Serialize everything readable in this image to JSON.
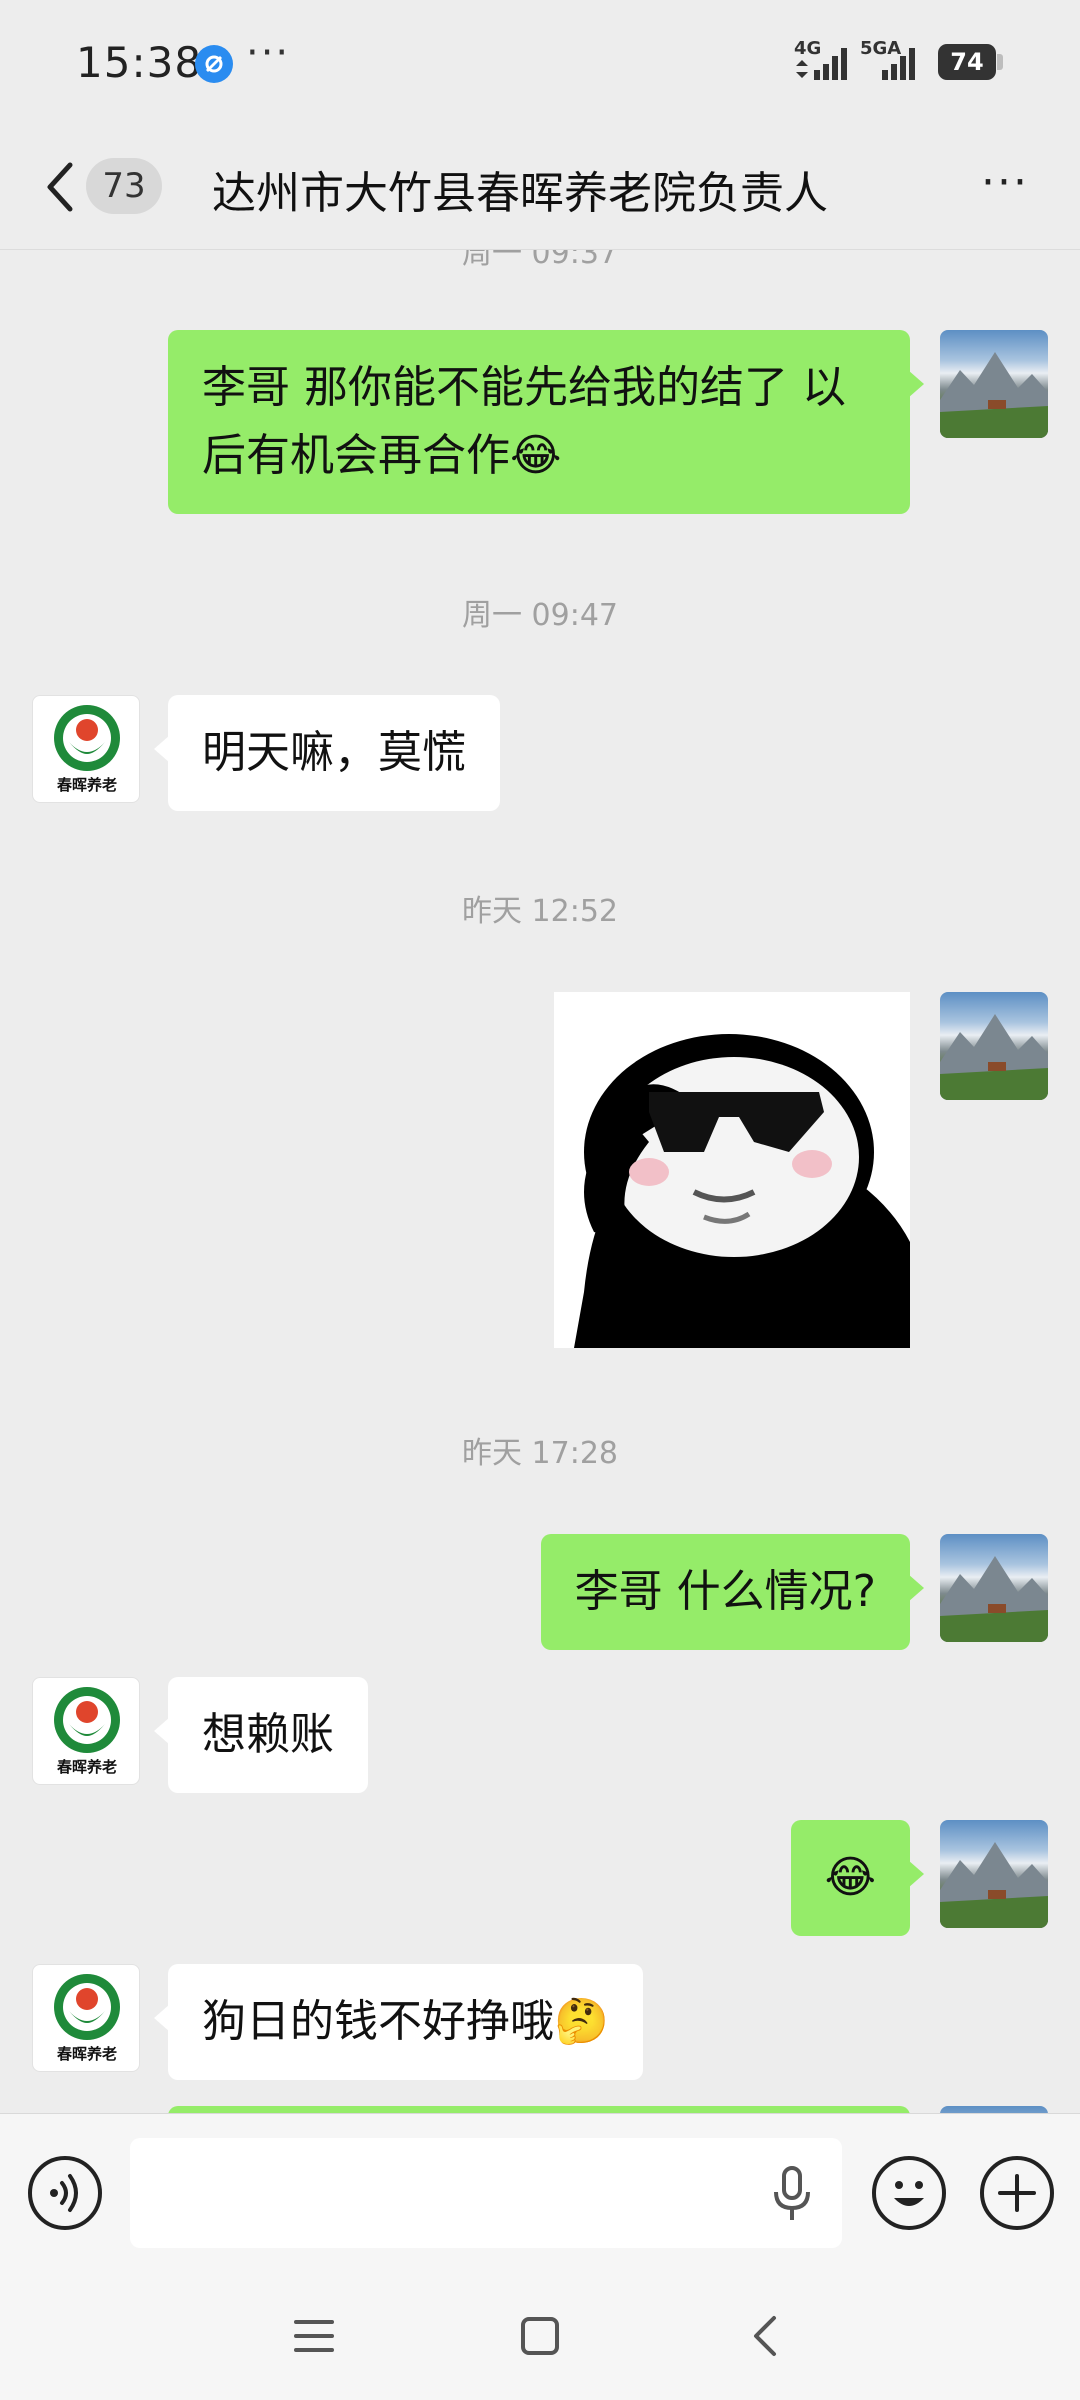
{
  "status_bar": {
    "time": "15:38",
    "more": "···",
    "network_1": "4G",
    "network_2": "5GA",
    "battery": "74"
  },
  "header": {
    "unread_count": "73",
    "title": "达州市大竹县春晖养老院负责人",
    "more": "···"
  },
  "messages": [
    {
      "type": "time",
      "text": "周一 09:37"
    },
    {
      "type": "text",
      "side": "self",
      "text": "李哥 那你能不能先给我的结了  以后有机会再合作😂"
    },
    {
      "type": "time",
      "text": "周一 09:47"
    },
    {
      "type": "text",
      "side": "other",
      "text": "明天嘛，莫慌"
    },
    {
      "type": "time",
      "text": "昨天 12:52"
    },
    {
      "type": "sticker",
      "side": "self",
      "sticker": "panda-sunglasses"
    },
    {
      "type": "time",
      "text": "昨天 17:28"
    },
    {
      "type": "text",
      "side": "self",
      "text": "李哥 什么情况?"
    },
    {
      "type": "text",
      "side": "other",
      "text": "想赖账"
    },
    {
      "type": "text",
      "side": "self",
      "text": "😂"
    },
    {
      "type": "text",
      "side": "other",
      "text": "狗日的钱不好挣哦🤔"
    }
  ],
  "avatar_other_text": "春晖养老",
  "input": {
    "value": "",
    "placeholder": ""
  },
  "colors": {
    "self_bubble": "#95ec69",
    "other_bubble": "#ffffff",
    "background": "#ededed",
    "timestamp": "#a0a0a0"
  }
}
